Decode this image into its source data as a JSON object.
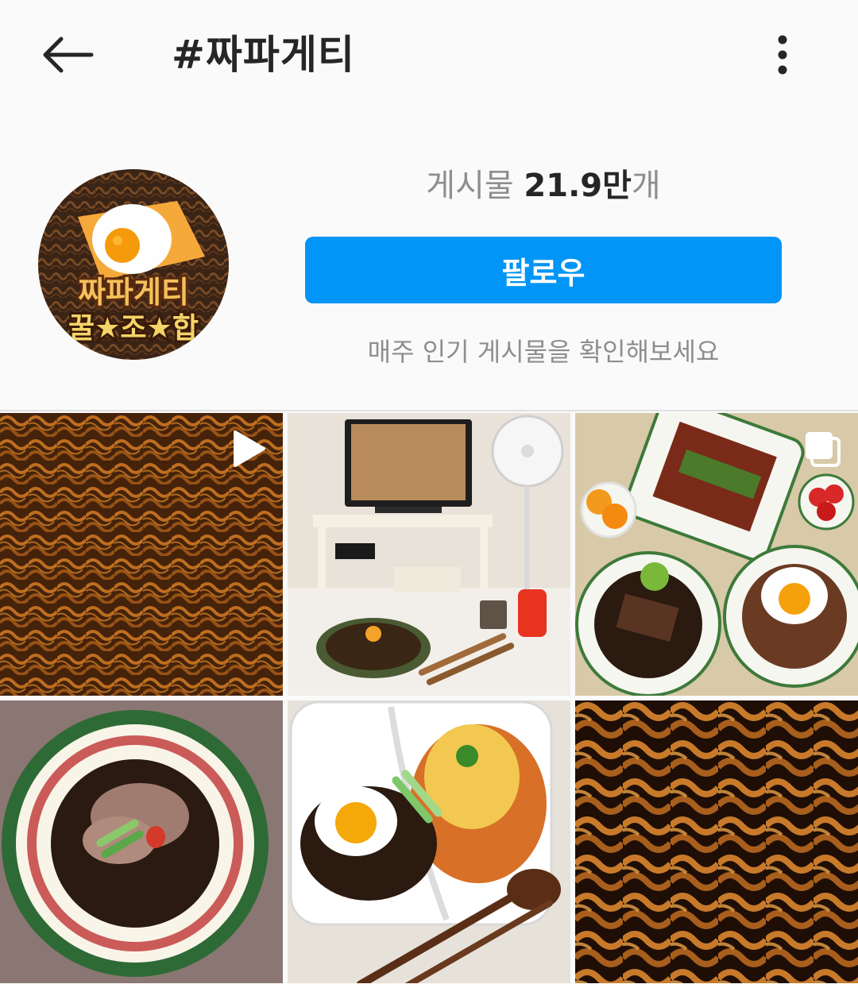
{
  "header": {
    "title": "#짜파게티",
    "back_icon": "arrow-left-icon",
    "more_icon": "more-vertical-icon"
  },
  "hashtag": {
    "post_count_label": "게시물",
    "post_count_value": "21.9만",
    "post_count_unit": "개",
    "follow_label": "팔로우",
    "weekly_text": "매주 인기 게시물을 확인해보세요",
    "avatar_text_line1": "짜파게티",
    "avatar_text_line2": "꿀★조★합"
  },
  "colors": {
    "follow_button": "#0095f6",
    "primary_text": "#262626",
    "secondary_text": "#8e8e8e"
  },
  "grid": {
    "posts": [
      {
        "kind": "video",
        "badge_icon": "play-icon"
      },
      {
        "kind": "image",
        "badge_icon": ""
      },
      {
        "kind": "carousel",
        "badge_icon": "carousel-icon"
      },
      {
        "kind": "image",
        "badge_icon": ""
      },
      {
        "kind": "image",
        "badge_icon": ""
      },
      {
        "kind": "image",
        "badge_icon": ""
      }
    ]
  }
}
